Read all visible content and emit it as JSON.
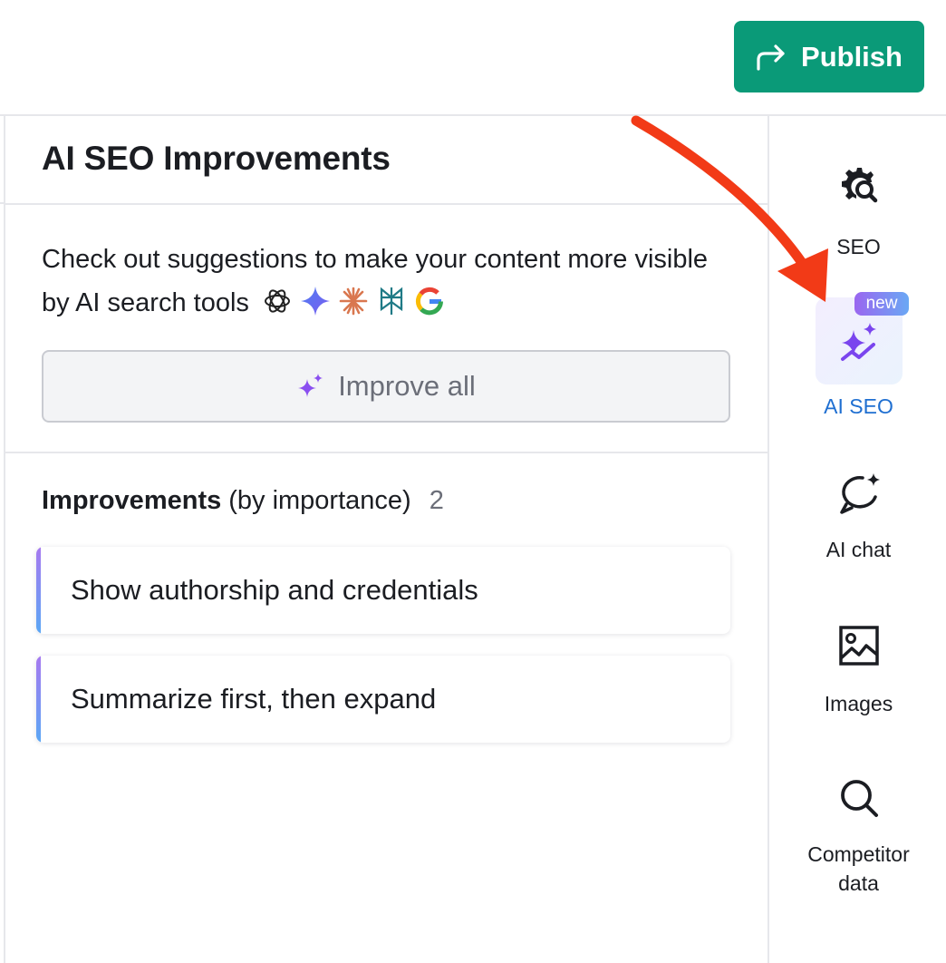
{
  "header": {
    "publish_label": "Publish"
  },
  "panel": {
    "title": "AI SEO Improvements",
    "description": "Check out suggestions to make your content more visible by AI search tools",
    "ai_tools_icons": [
      "chatgpt-icon",
      "gemini-icon",
      "claude-icon",
      "perplexity-icon",
      "google-icon"
    ],
    "improve_all_label": "Improve all",
    "improvements_heading_bold": "Improvements",
    "improvements_heading_rest": "(by importance)",
    "improvements_count": "2",
    "improvements": [
      "Show authorship and credentials",
      "Summarize first, then expand"
    ]
  },
  "sidebar": {
    "items": [
      {
        "label": "SEO",
        "icon": "seo-gear-icon"
      },
      {
        "label": "AI SEO",
        "icon": "sparkles-icon",
        "active": true,
        "badge": "new"
      },
      {
        "label": "AI chat",
        "icon": "ai-chat-icon"
      },
      {
        "label": "Images",
        "icon": "image-icon"
      },
      {
        "label": "Competitor data",
        "icon": "search-icon"
      }
    ]
  },
  "colors": {
    "publish_bg": "#0a9a78",
    "active_label": "#1f6fd1",
    "accent_purple": "#7a4ff0",
    "annotation_arrow": "#f23a17"
  }
}
